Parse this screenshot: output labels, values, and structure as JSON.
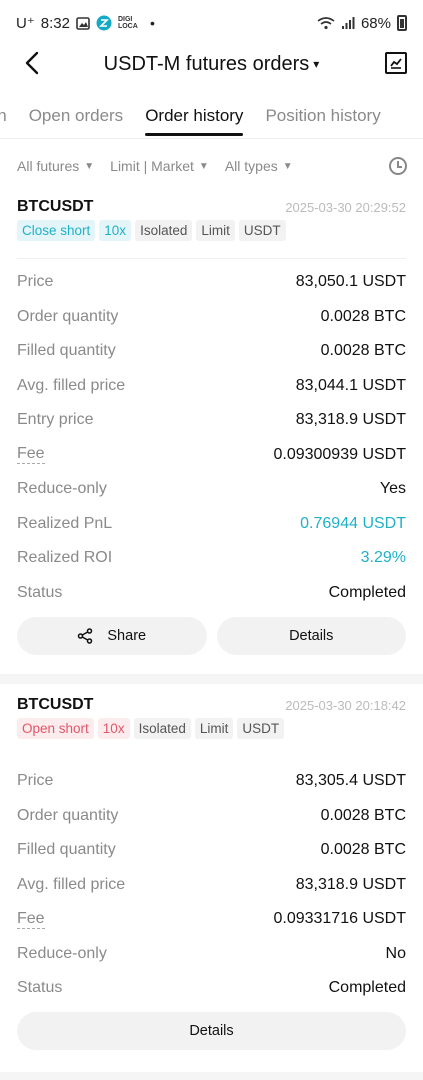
{
  "status_bar": {
    "carrier": "U⁺",
    "time": "8:32",
    "app_badge": "DIGI LOCA",
    "dot": "•",
    "battery": "68%"
  },
  "header": {
    "title": "USDT-M futures orders",
    "caret": "▾"
  },
  "tabs": [
    "ion",
    "Open orders",
    "Order history",
    "Position history"
  ],
  "active_tab": "Order history",
  "filters": [
    {
      "label": "All futures"
    },
    {
      "label": "Limit | Market"
    },
    {
      "label": "All types"
    }
  ],
  "orders": [
    {
      "symbol": "BTCUSDT",
      "timestamp": "2025-03-30 20:29:52",
      "tags": [
        "Close short",
        "10x",
        "Isolated",
        "Limit",
        "USDT"
      ],
      "rows": [
        {
          "label": "Price",
          "value": "83,050.1 USDT"
        },
        {
          "label": "Order quantity",
          "value": "0.0028 BTC"
        },
        {
          "label": "Filled quantity",
          "value": "0.0028 BTC"
        },
        {
          "label": "Avg. filled price",
          "value": "83,044.1 USDT"
        },
        {
          "label": "Entry price",
          "value": "83,318.9 USDT"
        },
        {
          "label": "Fee",
          "value": "0.09300939 USDT"
        },
        {
          "label": "Reduce-only",
          "value": "Yes"
        },
        {
          "label": "Realized PnL",
          "value": "0.76944 USDT"
        },
        {
          "label": "Realized ROI",
          "value": "3.29%"
        },
        {
          "label": "Status",
          "value": "Completed"
        }
      ],
      "share_label": "Share",
      "details_label": "Details"
    },
    {
      "symbol": "BTCUSDT",
      "timestamp": "2025-03-30 20:18:42",
      "tags": [
        "Open short",
        "10x",
        "Isolated",
        "Limit",
        "USDT"
      ],
      "rows": [
        {
          "label": "Price",
          "value": "83,305.4 USDT"
        },
        {
          "label": "Order quantity",
          "value": "0.0028 BTC"
        },
        {
          "label": "Filled quantity",
          "value": "0.0028 BTC"
        },
        {
          "label": "Avg. filled price",
          "value": "83,318.9 USDT"
        },
        {
          "label": "Fee",
          "value": "0.09331716 USDT"
        },
        {
          "label": "Reduce-only",
          "value": "No"
        },
        {
          "label": "Status",
          "value": "Completed"
        }
      ],
      "details_label": "Details"
    }
  ],
  "colors": {
    "teal": "#1fb1c8",
    "red": "#e0566a",
    "muted": "#8a8a8a"
  }
}
